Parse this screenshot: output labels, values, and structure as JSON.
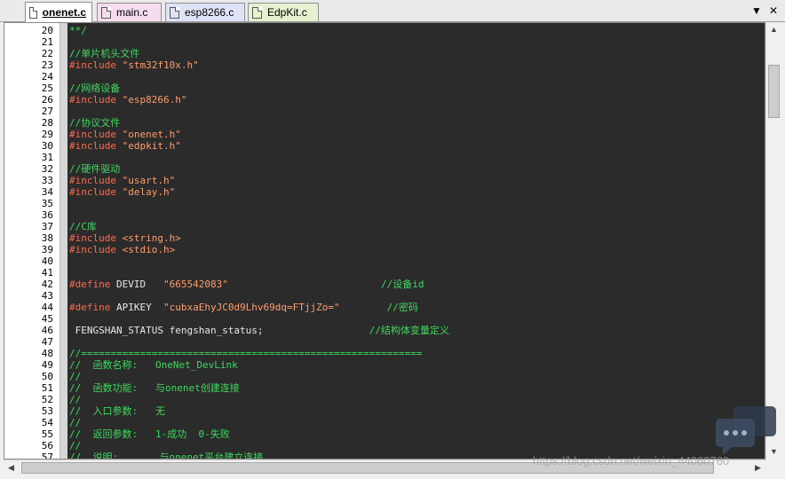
{
  "tabs": [
    {
      "label": "onenet.c",
      "color": "#ffffff",
      "active": true
    },
    {
      "label": "main.c",
      "color": "#f6dcef",
      "active": false
    },
    {
      "label": "esp8266.c",
      "color": "#dfe3f6",
      "active": false
    },
    {
      "label": "EdpKit.c",
      "color": "#e5f1cf",
      "active": false
    }
  ],
  "window_controls": {
    "dropdown": "▼",
    "close": "✕"
  },
  "lines": [
    {
      "n": "20",
      "segs": [
        [
          "comment",
          "**/"
        ]
      ]
    },
    {
      "n": "21",
      "segs": []
    },
    {
      "n": "22",
      "segs": [
        [
          "comment",
          "//单片机头文件"
        ]
      ]
    },
    {
      "n": "23",
      "segs": [
        [
          "pp",
          "#include "
        ],
        [
          "str",
          "\"stm32f10x.h\""
        ]
      ]
    },
    {
      "n": "24",
      "segs": []
    },
    {
      "n": "25",
      "segs": [
        [
          "comment",
          "//网络设备"
        ]
      ]
    },
    {
      "n": "26",
      "segs": [
        [
          "pp",
          "#include "
        ],
        [
          "str",
          "\"esp8266.h\""
        ]
      ]
    },
    {
      "n": "27",
      "segs": []
    },
    {
      "n": "28",
      "segs": [
        [
          "comment",
          "//协议文件"
        ]
      ]
    },
    {
      "n": "29",
      "segs": [
        [
          "pp",
          "#include "
        ],
        [
          "str",
          "\"onenet.h\""
        ]
      ]
    },
    {
      "n": "30",
      "segs": [
        [
          "pp",
          "#include "
        ],
        [
          "str",
          "\"edpkit.h\""
        ]
      ]
    },
    {
      "n": "31",
      "segs": []
    },
    {
      "n": "32",
      "segs": [
        [
          "comment",
          "//硬件驱动"
        ]
      ]
    },
    {
      "n": "33",
      "segs": [
        [
          "pp",
          "#include "
        ],
        [
          "str",
          "\"usart.h\""
        ]
      ]
    },
    {
      "n": "34",
      "segs": [
        [
          "pp",
          "#include "
        ],
        [
          "str",
          "\"delay.h\""
        ]
      ]
    },
    {
      "n": "35",
      "segs": []
    },
    {
      "n": "36",
      "segs": []
    },
    {
      "n": "37",
      "segs": [
        [
          "comment",
          "//C库"
        ]
      ]
    },
    {
      "n": "38",
      "segs": [
        [
          "pp",
          "#include "
        ],
        [
          "str",
          "<string.h>"
        ]
      ]
    },
    {
      "n": "39",
      "segs": [
        [
          "pp",
          "#include "
        ],
        [
          "str",
          "<stdio.h>"
        ]
      ]
    },
    {
      "n": "40",
      "segs": []
    },
    {
      "n": "41",
      "segs": []
    },
    {
      "n": "42",
      "segs": [
        [
          "pp",
          "#define "
        ],
        [
          "plain",
          "DEVID   "
        ],
        [
          "str",
          "\"665542083\""
        ],
        [
          "plain",
          "                          "
        ],
        [
          "comment",
          "//设备id"
        ]
      ]
    },
    {
      "n": "43",
      "segs": []
    },
    {
      "n": "44",
      "segs": [
        [
          "pp",
          "#define "
        ],
        [
          "plain",
          "APIKEY  "
        ],
        [
          "str",
          "\"cubxaEhyJC0d9Lhv69dq=FTjjZo=\""
        ],
        [
          "plain",
          "        "
        ],
        [
          "comment",
          "//密码"
        ]
      ]
    },
    {
      "n": "45",
      "segs": []
    },
    {
      "n": "46",
      "segs": [
        [
          "plain",
          " FENGSHAN_STATUS fengshan_status;"
        ],
        [
          "plain",
          "                  "
        ],
        [
          "comment",
          "//结构体变量定义"
        ]
      ]
    },
    {
      "n": "47",
      "segs": []
    },
    {
      "n": "48",
      "segs": [
        [
          "comment",
          "//=========================================================="
        ]
      ]
    },
    {
      "n": "49",
      "segs": [
        [
          "comment",
          "//  函数名称:   OneNet_DevLink"
        ]
      ]
    },
    {
      "n": "50",
      "segs": [
        [
          "comment",
          "//"
        ]
      ]
    },
    {
      "n": "51",
      "segs": [
        [
          "comment",
          "//  函数功能:   与onenet创建连接"
        ]
      ]
    },
    {
      "n": "52",
      "segs": [
        [
          "comment",
          "//"
        ]
      ]
    },
    {
      "n": "53",
      "segs": [
        [
          "comment",
          "//  入口参数:   无"
        ]
      ]
    },
    {
      "n": "54",
      "segs": [
        [
          "comment",
          "//"
        ]
      ]
    },
    {
      "n": "55",
      "segs": [
        [
          "comment",
          "//  返回参数:   1-成功  0-失败"
        ]
      ]
    },
    {
      "n": "56",
      "segs": [
        [
          "comment",
          "//"
        ]
      ]
    },
    {
      "n": "57",
      "segs": [
        [
          "comment",
          "//  说明:       与onenet平台建立连接"
        ]
      ]
    }
  ],
  "watermark": "https://blog.csdn.net/weixin_44060760",
  "icons": {
    "chat": "chat-bubble-icon"
  }
}
